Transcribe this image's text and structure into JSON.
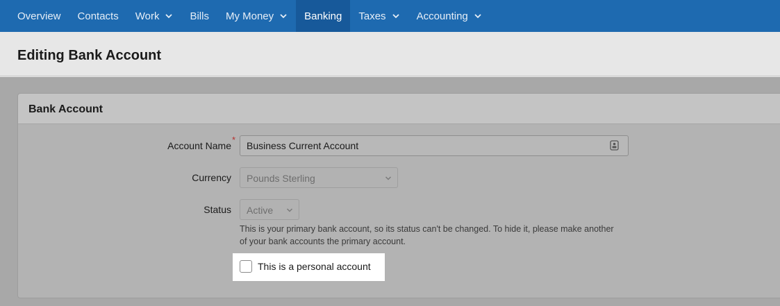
{
  "nav": {
    "items": [
      {
        "label": "Overview",
        "dropdown": false,
        "active": false
      },
      {
        "label": "Contacts",
        "dropdown": false,
        "active": false
      },
      {
        "label": "Work",
        "dropdown": true,
        "active": false
      },
      {
        "label": "Bills",
        "dropdown": false,
        "active": false
      },
      {
        "label": "My Money",
        "dropdown": true,
        "active": false
      },
      {
        "label": "Banking",
        "dropdown": false,
        "active": true
      },
      {
        "label": "Taxes",
        "dropdown": true,
        "active": false
      },
      {
        "label": "Accounting",
        "dropdown": true,
        "active": false
      }
    ]
  },
  "page": {
    "title": "Editing Bank Account"
  },
  "panel": {
    "title": "Bank Account",
    "account_name": {
      "label": "Account Name",
      "required_mark": "*",
      "value": "Business Current Account"
    },
    "currency": {
      "label": "Currency",
      "selected": "Pounds Sterling"
    },
    "status": {
      "label": "Status",
      "selected": "Active",
      "help": "This is your primary bank account, so its status can't be changed. To hide it, please make another of your bank accounts the primary account."
    },
    "personal": {
      "label": "This is a personal account",
      "checked": false
    }
  },
  "colors": {
    "nav_bg": "#1e6ab0",
    "nav_active": "#17599a",
    "required": "#b5302d"
  }
}
